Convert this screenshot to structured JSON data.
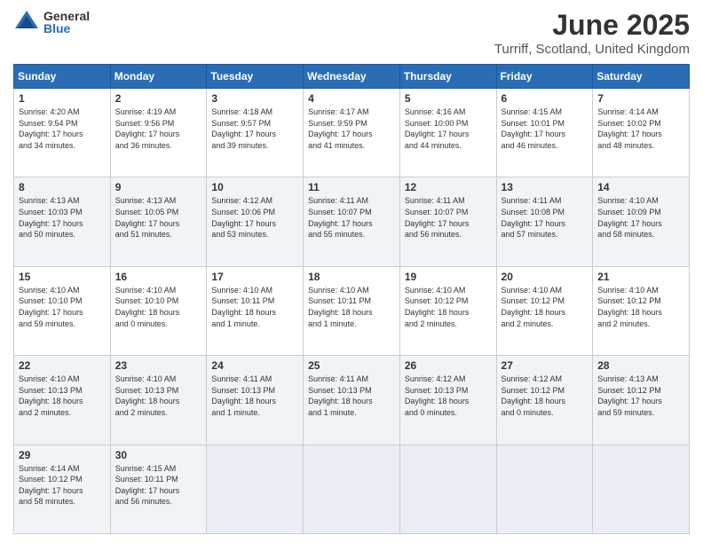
{
  "header": {
    "logo_general": "General",
    "logo_blue": "Blue",
    "title": "June 2025",
    "subtitle": "Turriff, Scotland, United Kingdom"
  },
  "days_of_week": [
    "Sunday",
    "Monday",
    "Tuesday",
    "Wednesday",
    "Thursday",
    "Friday",
    "Saturday"
  ],
  "weeks": [
    [
      {
        "day": "1",
        "info": "Sunrise: 4:20 AM\nSunset: 9:54 PM\nDaylight: 17 hours\nand 34 minutes."
      },
      {
        "day": "2",
        "info": "Sunrise: 4:19 AM\nSunset: 9:56 PM\nDaylight: 17 hours\nand 36 minutes."
      },
      {
        "day": "3",
        "info": "Sunrise: 4:18 AM\nSunset: 9:57 PM\nDaylight: 17 hours\nand 39 minutes."
      },
      {
        "day": "4",
        "info": "Sunrise: 4:17 AM\nSunset: 9:59 PM\nDaylight: 17 hours\nand 41 minutes."
      },
      {
        "day": "5",
        "info": "Sunrise: 4:16 AM\nSunset: 10:00 PM\nDaylight: 17 hours\nand 44 minutes."
      },
      {
        "day": "6",
        "info": "Sunrise: 4:15 AM\nSunset: 10:01 PM\nDaylight: 17 hours\nand 46 minutes."
      },
      {
        "day": "7",
        "info": "Sunrise: 4:14 AM\nSunset: 10:02 PM\nDaylight: 17 hours\nand 48 minutes."
      }
    ],
    [
      {
        "day": "8",
        "info": "Sunrise: 4:13 AM\nSunset: 10:03 PM\nDaylight: 17 hours\nand 50 minutes."
      },
      {
        "day": "9",
        "info": "Sunrise: 4:13 AM\nSunset: 10:05 PM\nDaylight: 17 hours\nand 51 minutes."
      },
      {
        "day": "10",
        "info": "Sunrise: 4:12 AM\nSunset: 10:06 PM\nDaylight: 17 hours\nand 53 minutes."
      },
      {
        "day": "11",
        "info": "Sunrise: 4:11 AM\nSunset: 10:07 PM\nDaylight: 17 hours\nand 55 minutes."
      },
      {
        "day": "12",
        "info": "Sunrise: 4:11 AM\nSunset: 10:07 PM\nDaylight: 17 hours\nand 56 minutes."
      },
      {
        "day": "13",
        "info": "Sunrise: 4:11 AM\nSunset: 10:08 PM\nDaylight: 17 hours\nand 57 minutes."
      },
      {
        "day": "14",
        "info": "Sunrise: 4:10 AM\nSunset: 10:09 PM\nDaylight: 17 hours\nand 58 minutes."
      }
    ],
    [
      {
        "day": "15",
        "info": "Sunrise: 4:10 AM\nSunset: 10:10 PM\nDaylight: 17 hours\nand 59 minutes."
      },
      {
        "day": "16",
        "info": "Sunrise: 4:10 AM\nSunset: 10:10 PM\nDaylight: 18 hours\nand 0 minutes."
      },
      {
        "day": "17",
        "info": "Sunrise: 4:10 AM\nSunset: 10:11 PM\nDaylight: 18 hours\nand 1 minute."
      },
      {
        "day": "18",
        "info": "Sunrise: 4:10 AM\nSunset: 10:11 PM\nDaylight: 18 hours\nand 1 minute."
      },
      {
        "day": "19",
        "info": "Sunrise: 4:10 AM\nSunset: 10:12 PM\nDaylight: 18 hours\nand 2 minutes."
      },
      {
        "day": "20",
        "info": "Sunrise: 4:10 AM\nSunset: 10:12 PM\nDaylight: 18 hours\nand 2 minutes."
      },
      {
        "day": "21",
        "info": "Sunrise: 4:10 AM\nSunset: 10:12 PM\nDaylight: 18 hours\nand 2 minutes."
      }
    ],
    [
      {
        "day": "22",
        "info": "Sunrise: 4:10 AM\nSunset: 10:13 PM\nDaylight: 18 hours\nand 2 minutes."
      },
      {
        "day": "23",
        "info": "Sunrise: 4:10 AM\nSunset: 10:13 PM\nDaylight: 18 hours\nand 2 minutes."
      },
      {
        "day": "24",
        "info": "Sunrise: 4:11 AM\nSunset: 10:13 PM\nDaylight: 18 hours\nand 1 minute."
      },
      {
        "day": "25",
        "info": "Sunrise: 4:11 AM\nSunset: 10:13 PM\nDaylight: 18 hours\nand 1 minute."
      },
      {
        "day": "26",
        "info": "Sunrise: 4:12 AM\nSunset: 10:13 PM\nDaylight: 18 hours\nand 0 minutes."
      },
      {
        "day": "27",
        "info": "Sunrise: 4:12 AM\nSunset: 10:12 PM\nDaylight: 18 hours\nand 0 minutes."
      },
      {
        "day": "28",
        "info": "Sunrise: 4:13 AM\nSunset: 10:12 PM\nDaylight: 17 hours\nand 59 minutes."
      }
    ],
    [
      {
        "day": "29",
        "info": "Sunrise: 4:14 AM\nSunset: 10:12 PM\nDaylight: 17 hours\nand 58 minutes."
      },
      {
        "day": "30",
        "info": "Sunrise: 4:15 AM\nSunset: 10:11 PM\nDaylight: 17 hours\nand 56 minutes."
      },
      null,
      null,
      null,
      null,
      null
    ]
  ]
}
